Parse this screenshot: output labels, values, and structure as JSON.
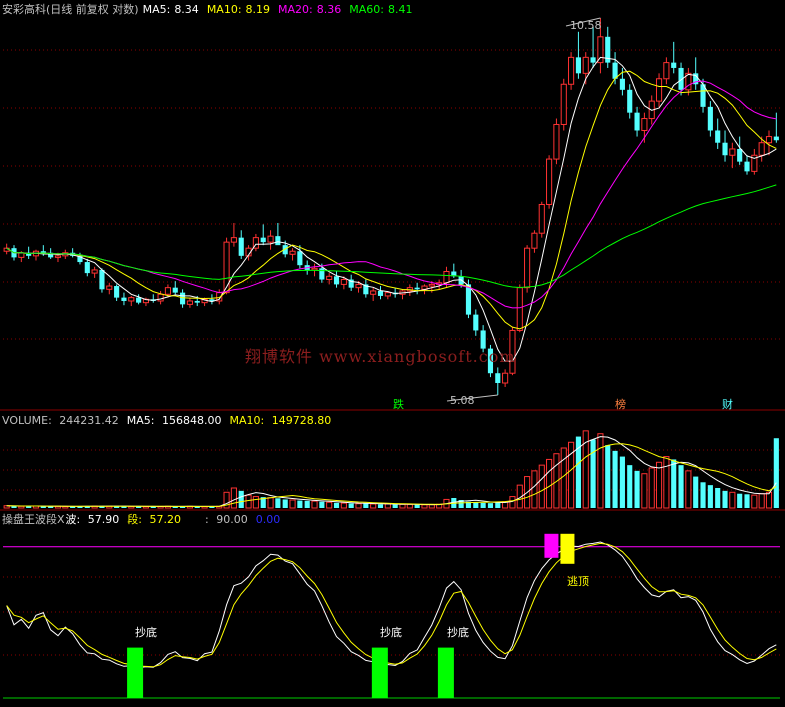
{
  "colors": {
    "up": "#ff3232",
    "down": "#54ffff",
    "ma5": "#ffffff",
    "ma10": "#ffff00",
    "ma20": "#ff00ff",
    "ma60": "#00ff00",
    "label": "#c0c0c0",
    "grid": "#8b0000",
    "bottom_signal": "#00ff00",
    "top_signal_1": "#ff00ff",
    "top_signal_2": "#ffff00"
  },
  "price_panel": {
    "stock": "安彩高科(日线 前复权 对数)",
    "ma5_label": "MA5:",
    "ma5_value": "8.34",
    "ma10_label": "MA10:",
    "ma10_value": "8.19",
    "ma20_label": "MA20:",
    "ma20_value": "8.36",
    "ma60_label": "MA60:",
    "ma60_value": "8.41",
    "high_label": "10.58",
    "low_label": "5.08",
    "tag_die": "跌",
    "tag_bang": "榜",
    "tag_cai": "财"
  },
  "volume_panel": {
    "label": "VOLUME:",
    "value": "244231.42",
    "ma5_label": "MA5:",
    "ma5_value": "156848.00",
    "ma10_label": "MA10:",
    "ma10_value": "149728.80"
  },
  "indicator_panel": {
    "name": "操盘王波段X",
    "wave_label": "波:",
    "wave_value": "57.90",
    "band_label": "段:",
    "band_value": "57.20",
    "level_label": ":",
    "level_value": "90.00",
    "zero_value": "0.00",
    "bottom_label": "抄底",
    "top_label": "逃顶"
  },
  "watermark": "翔博软件 www.xiangbosoft.com",
  "chart_data": [
    {
      "type": "candlestick",
      "title": "安彩高科(日线 前复权 对数)",
      "scale": "log",
      "ylim": [
        5.08,
        10.58
      ],
      "annotations": [
        {
          "text": "10.58",
          "kind": "period-high"
        },
        {
          "text": "5.08",
          "kind": "period-low"
        }
      ],
      "grid": true,
      "series": [
        {
          "name": "MA5",
          "last": 8.34
        },
        {
          "name": "MA10",
          "last": 8.19
        },
        {
          "name": "MA20",
          "last": 8.36
        },
        {
          "name": "MA60",
          "last": 8.41
        }
      ],
      "candles": [
        [
          6.72,
          6.82,
          6.68,
          6.76
        ],
        [
          6.76,
          6.8,
          6.6,
          6.64
        ],
        [
          6.64,
          6.72,
          6.58,
          6.7
        ],
        [
          6.7,
          6.78,
          6.62,
          6.66
        ],
        [
          6.66,
          6.74,
          6.6,
          6.72
        ],
        [
          6.72,
          6.8,
          6.66,
          6.7
        ],
        [
          6.7,
          6.76,
          6.62,
          6.64
        ],
        [
          6.64,
          6.7,
          6.58,
          6.66
        ],
        [
          6.66,
          6.74,
          6.62,
          6.7
        ],
        [
          6.7,
          6.76,
          6.64,
          6.66
        ],
        [
          6.66,
          6.7,
          6.55,
          6.58
        ],
        [
          6.58,
          6.62,
          6.4,
          6.44
        ],
        [
          6.44,
          6.52,
          6.38,
          6.48
        ],
        [
          6.48,
          6.5,
          6.2,
          6.24
        ],
        [
          6.24,
          6.32,
          6.18,
          6.28
        ],
        [
          6.28,
          6.3,
          6.1,
          6.14
        ],
        [
          6.14,
          6.2,
          6.05,
          6.1
        ],
        [
          6.1,
          6.16,
          6.04,
          6.14
        ],
        [
          6.14,
          6.18,
          6.06,
          6.08
        ],
        [
          6.08,
          6.14,
          6.04,
          6.12
        ],
        [
          6.12,
          6.18,
          6.08,
          6.1
        ],
        [
          6.1,
          6.22,
          6.06,
          6.18
        ],
        [
          6.18,
          6.3,
          6.14,
          6.26
        ],
        [
          6.26,
          6.34,
          6.18,
          6.2
        ],
        [
          6.2,
          6.24,
          6.02,
          6.06
        ],
        [
          6.06,
          6.14,
          6.02,
          6.1
        ],
        [
          6.1,
          6.16,
          6.04,
          6.08
        ],
        [
          6.08,
          6.14,
          6.04,
          6.12
        ],
        [
          6.12,
          6.18,
          6.06,
          6.1
        ],
        [
          6.1,
          6.24,
          6.06,
          6.2
        ],
        [
          6.2,
          6.9,
          6.18,
          6.84
        ],
        [
          6.84,
          7.1,
          6.78,
          6.9
        ],
        [
          6.9,
          7.0,
          6.62,
          6.66
        ],
        [
          6.66,
          6.8,
          6.6,
          6.76
        ],
        [
          6.76,
          6.95,
          6.72,
          6.9
        ],
        [
          6.9,
          7.08,
          6.8,
          6.84
        ],
        [
          6.84,
          7.0,
          6.74,
          6.92
        ],
        [
          6.92,
          7.1,
          6.86,
          6.8
        ],
        [
          6.8,
          6.86,
          6.64,
          6.68
        ],
        [
          6.68,
          6.76,
          6.6,
          6.72
        ],
        [
          6.72,
          6.8,
          6.5,
          6.54
        ],
        [
          6.54,
          6.6,
          6.42,
          6.48
        ],
        [
          6.48,
          6.56,
          6.4,
          6.5
        ],
        [
          6.5,
          6.56,
          6.32,
          6.36
        ],
        [
          6.36,
          6.44,
          6.3,
          6.4
        ],
        [
          6.4,
          6.46,
          6.26,
          6.3
        ],
        [
          6.3,
          6.4,
          6.24,
          6.36
        ],
        [
          6.36,
          6.42,
          6.22,
          6.26
        ],
        [
          6.26,
          6.34,
          6.2,
          6.3
        ],
        [
          6.3,
          6.36,
          6.14,
          6.18
        ],
        [
          6.18,
          6.26,
          6.1,
          6.22
        ],
        [
          6.22,
          6.28,
          6.12,
          6.16
        ],
        [
          6.16,
          6.22,
          6.12,
          6.2
        ],
        [
          6.2,
          6.26,
          6.14,
          6.18
        ],
        [
          6.18,
          6.24,
          6.12,
          6.22
        ],
        [
          6.22,
          6.3,
          6.16,
          6.26
        ],
        [
          6.26,
          6.32,
          6.18,
          6.24
        ],
        [
          6.24,
          6.3,
          6.18,
          6.28
        ],
        [
          6.28,
          6.34,
          6.2,
          6.3
        ],
        [
          6.3,
          6.36,
          6.24,
          6.32
        ],
        [
          6.32,
          6.52,
          6.26,
          6.46
        ],
        [
          6.46,
          6.56,
          6.38,
          6.4
        ],
        [
          6.4,
          6.48,
          6.26,
          6.3
        ],
        [
          6.3,
          6.36,
          5.9,
          5.94
        ],
        [
          5.94,
          6.0,
          5.7,
          5.76
        ],
        [
          5.76,
          5.82,
          5.52,
          5.56
        ],
        [
          5.56,
          5.6,
          5.26,
          5.3
        ],
        [
          5.3,
          5.36,
          5.08,
          5.2
        ],
        [
          5.2,
          5.34,
          5.16,
          5.3
        ],
        [
          5.3,
          5.8,
          5.28,
          5.76
        ],
        [
          5.76,
          6.3,
          5.74,
          6.26
        ],
        [
          6.26,
          6.8,
          6.2,
          6.76
        ],
        [
          6.76,
          7.0,
          6.7,
          6.96
        ],
        [
          6.96,
          7.4,
          6.9,
          7.36
        ],
        [
          7.36,
          8.1,
          7.3,
          8.04
        ],
        [
          8.04,
          8.7,
          7.96,
          8.6
        ],
        [
          8.6,
          9.4,
          8.5,
          9.3
        ],
        [
          9.3,
          9.9,
          9.2,
          9.8
        ],
        [
          9.8,
          10.3,
          9.4,
          9.5
        ],
        [
          9.5,
          9.9,
          9.3,
          9.8
        ],
        [
          9.8,
          10.4,
          9.6,
          9.7
        ],
        [
          9.7,
          10.58,
          9.5,
          10.2
        ],
        [
          10.2,
          10.4,
          9.6,
          9.7
        ],
        [
          9.7,
          9.9,
          9.3,
          9.4
        ],
        [
          9.4,
          9.6,
          9.1,
          9.2
        ],
        [
          9.2,
          9.3,
          8.7,
          8.8
        ],
        [
          8.8,
          8.9,
          8.4,
          8.5
        ],
        [
          8.5,
          8.8,
          8.3,
          8.7
        ],
        [
          8.7,
          9.1,
          8.6,
          9.0
        ],
        [
          9.0,
          9.5,
          8.9,
          9.4
        ],
        [
          9.4,
          9.8,
          9.3,
          9.7
        ],
        [
          9.7,
          10.1,
          9.5,
          9.6
        ],
        [
          9.6,
          9.7,
          9.1,
          9.2
        ],
        [
          9.2,
          9.6,
          9.1,
          9.5
        ],
        [
          9.5,
          9.8,
          9.2,
          9.3
        ],
        [
          9.3,
          9.4,
          8.8,
          8.9
        ],
        [
          8.9,
          9.0,
          8.4,
          8.5
        ],
        [
          8.5,
          8.7,
          8.2,
          8.3
        ],
        [
          8.3,
          8.5,
          8.0,
          8.1
        ],
        [
          8.1,
          8.3,
          7.9,
          8.2
        ],
        [
          8.2,
          8.4,
          7.95,
          8.0
        ],
        [
          8.0,
          8.1,
          7.8,
          7.85
        ],
        [
          7.85,
          8.2,
          7.8,
          8.1
        ],
        [
          8.1,
          8.4,
          8.0,
          8.3
        ],
        [
          8.3,
          8.5,
          8.1,
          8.4
        ],
        [
          8.4,
          8.8,
          8.3,
          8.34
        ]
      ]
    },
    {
      "type": "bar",
      "title": "VOLUME",
      "ylim": [
        0,
        280000
      ],
      "series": [
        {
          "name": "VOLUME",
          "last": 244231.42
        },
        {
          "name": "MA5",
          "last": 156848.0
        },
        {
          "name": "MA10",
          "last": 149728.8
        }
      ],
      "values": [
        8000,
        7000,
        6000,
        6500,
        7000,
        6000,
        5500,
        6000,
        5000,
        5200,
        6000,
        7000,
        6500,
        7500,
        6000,
        6500,
        6000,
        5500,
        5800,
        5000,
        5200,
        5600,
        6000,
        5500,
        6000,
        5800,
        5400,
        5200,
        5600,
        6000,
        55000,
        70000,
        60000,
        45000,
        40000,
        38000,
        36000,
        34000,
        30000,
        28000,
        26000,
        25000,
        24000,
        22000,
        20000,
        18000,
        17000,
        16000,
        15000,
        16000,
        14000,
        13000,
        14000,
        12000,
        13000,
        12500,
        12000,
        11000,
        11500,
        13000,
        30000,
        35000,
        28000,
        22000,
        20000,
        18000,
        17000,
        19000,
        22000,
        40000,
        80000,
        110000,
        130000,
        150000,
        170000,
        190000,
        210000,
        230000,
        250000,
        270000,
        240000,
        260000,
        220000,
        200000,
        180000,
        150000,
        130000,
        120000,
        140000,
        160000,
        180000,
        170000,
        150000,
        130000,
        110000,
        90000,
        80000,
        70000,
        60000,
        55000,
        50000,
        48000,
        45000,
        50000,
        55000,
        244231
      ]
    },
    {
      "type": "line",
      "title": "操盘王波段X",
      "ylim": [
        0,
        100
      ],
      "reference_lines": [
        90,
        0
      ],
      "series": [
        {
          "name": "波",
          "last": 57.9
        },
        {
          "name": "段",
          "last": 57.2
        }
      ],
      "signals": [
        {
          "label": "抄底",
          "at": 0.17
        },
        {
          "label": "抄底",
          "at": 0.485
        },
        {
          "label": "抄底",
          "at": 0.57
        },
        {
          "label": "逃顶",
          "at": 0.72
        }
      ]
    }
  ]
}
